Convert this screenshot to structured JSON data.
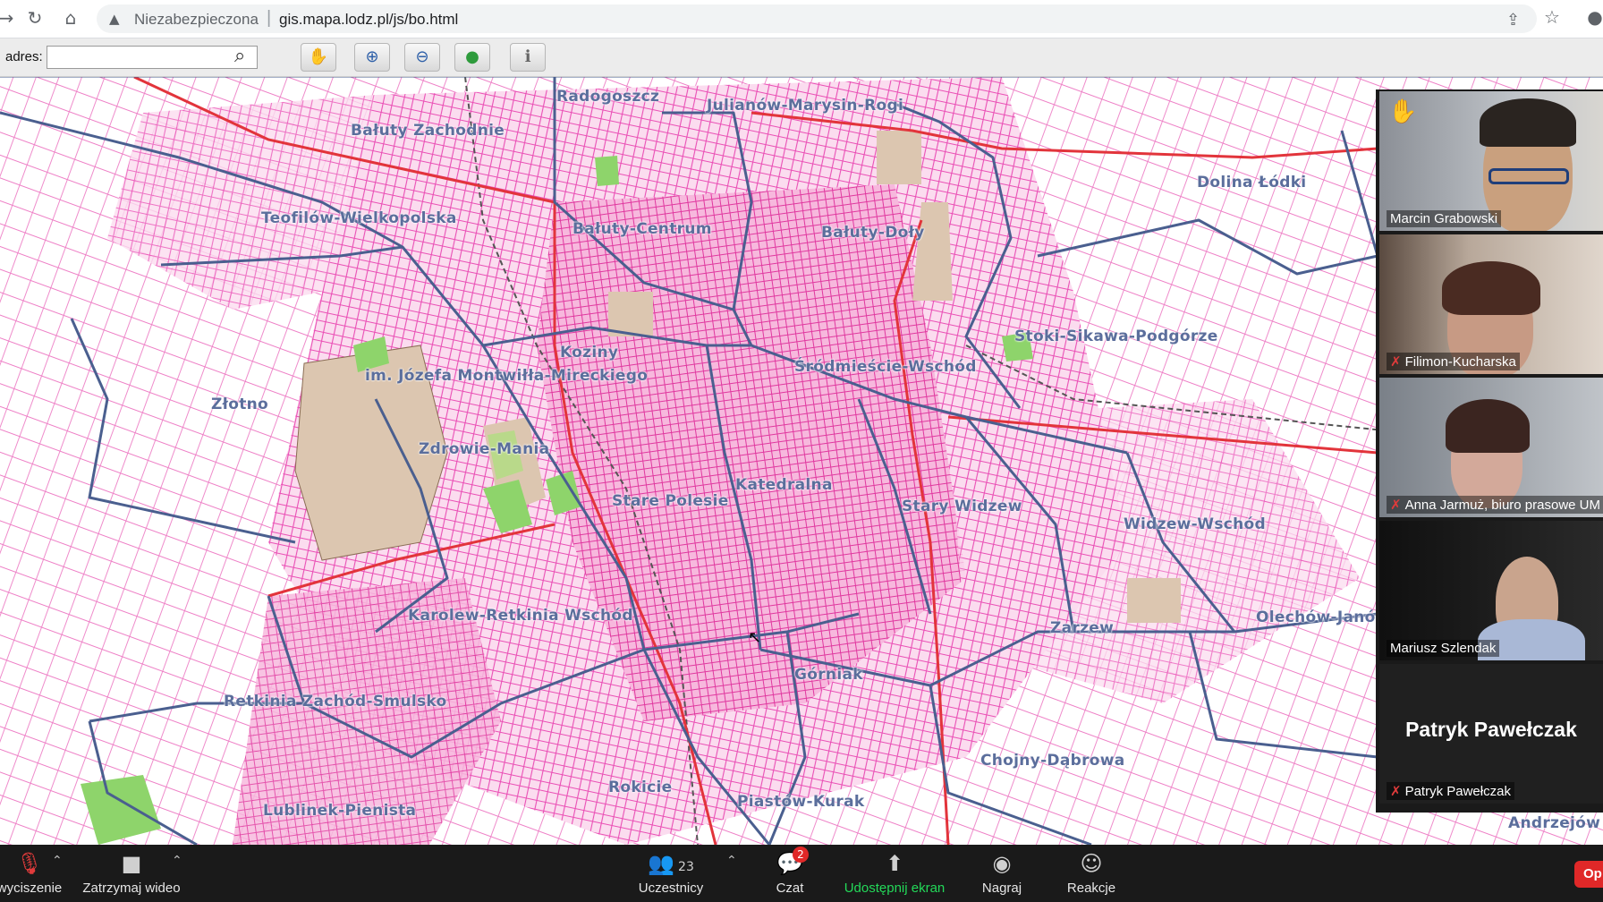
{
  "browser": {
    "security_label": "Niezabezpieczona",
    "url": "gis.mapa.lodz.pl/js/bo.html",
    "icons": [
      "back-arrow-icon",
      "reload-icon",
      "home-icon",
      "warning-icon",
      "share-icon",
      "star-icon",
      "profile-icon"
    ]
  },
  "map_toolbar": {
    "address_label": "adres:",
    "address_value": "",
    "tools": [
      "pan-hand-icon",
      "zoom-in-icon",
      "zoom-out-icon",
      "globe-icon",
      "info-icon"
    ]
  },
  "map": {
    "districts": [
      "Radogoszcz",
      "Julianów-Marysin-Rogi",
      "Bałuty Zachodnie",
      "Teofilów-Wielkopolska",
      "Bałuty-Centrum",
      "Bałuty-Doły",
      "Dolina Łódki",
      "Koziny",
      "im. Józefa Montwiłła-Mireckiego",
      "Śródmieście-Wschód",
      "Stoki-Sikawa-Podgórze",
      "Złotno",
      "Zdrowie-Mania",
      "Katedralna",
      "Stare Polesie",
      "Stary Widzew",
      "Widzew-Wschód",
      "Karolew-Retkinia Wschód",
      "Zarzew",
      "Olechów-Janów",
      "Retkinia Zachód-Smulsko",
      "Górniak",
      "Chojny-Dąbrowa",
      "Rokicie",
      "Piastów-Kurak",
      "Lublinek-Pienista",
      "Andrzejów"
    ]
  },
  "participants": [
    {
      "name": "Marcin Grabowski",
      "muted": false,
      "hand_raised": true
    },
    {
      "name": "Filimon-Kucharska",
      "muted": true
    },
    {
      "name": "Anna Jarmuż, biuro prasowe UM",
      "muted": true
    },
    {
      "name": "Mariusz Szlendak",
      "muted": false
    },
    {
      "name": "Patryk Pawełczak",
      "muted": true,
      "display_name": "Patryk Pawełczak"
    }
  ],
  "zoom_toolbar": {
    "mute_label": "wyciszenie",
    "video_label": "Zatrzymaj wideo",
    "participants_label": "Uczestnicy",
    "participants_count": "23",
    "chat_label": "Czat",
    "chat_badge": "2",
    "share_label": "Udostępnij ekran",
    "record_label": "Nagraj",
    "reactions_label": "Reakcje",
    "end_label": "Op"
  }
}
